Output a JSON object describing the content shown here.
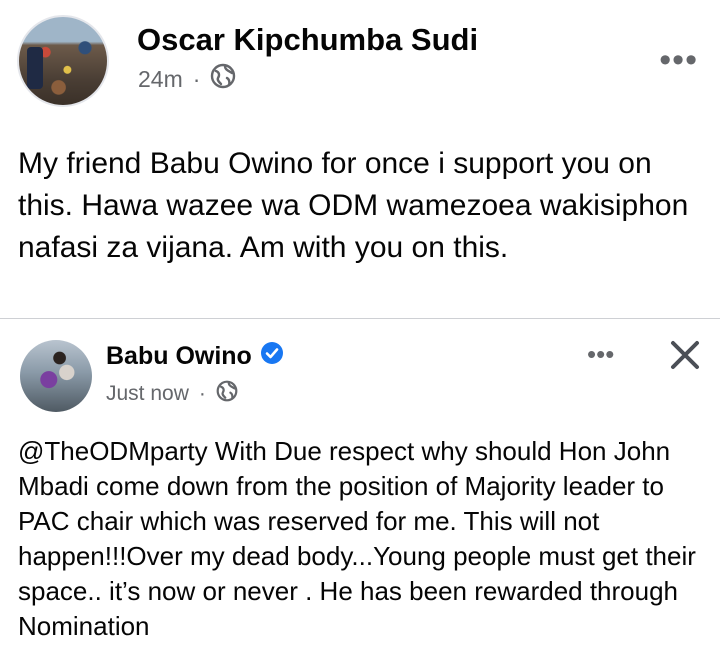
{
  "post": {
    "author": "Oscar Kipchumba Sudi",
    "time": "24m",
    "separator": "·",
    "audience_icon": "globe-icon",
    "more_label": "•••",
    "text": "My friend Babu Owino for once i support you on this. Hawa wazee wa ODM wamezoea wakisiphon nafasi za vijana. Am with you on this."
  },
  "shared": {
    "author": "Babu Owino",
    "verified_icon": "verified-badge-icon",
    "time": "Just now",
    "separator": "·",
    "audience_icon": "globe-icon",
    "more_label": "•••",
    "close_icon": "close-icon",
    "text": "@TheODMparty With Due respect why should Hon John Mbadi come down from the position of Majority leader to PAC chair which was reserved for me. This will not happen!!!Over my dead body...Young people must get their space.. it’s now or never . He has been rewarded through Nomination"
  },
  "colors": {
    "text": "#050505",
    "secondary": "#65676b",
    "verified": "#1877f2",
    "divider": "#ced0d4"
  }
}
